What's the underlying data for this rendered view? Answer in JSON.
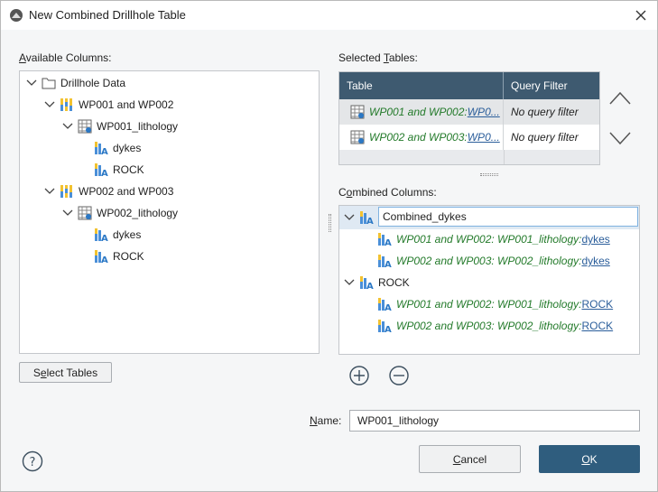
{
  "window": {
    "title": "New Combined Drillhole Table"
  },
  "available_columns": {
    "label": "Available Columns:",
    "label_underline": "A",
    "label_rest": "vailable Columns:",
    "tree": {
      "root": "Drillhole Data",
      "group1": "WP001 and WP002",
      "group1_table": "WP001_lithology",
      "group1_cols": [
        "dykes",
        "ROCK"
      ],
      "group2": "WP002 and WP003",
      "group2_table": "WP002_lithology",
      "group2_cols": [
        "dykes",
        "ROCK"
      ]
    }
  },
  "select_tables_button": {
    "pre": "S",
    "underline": "e",
    "post": "lect Tables"
  },
  "selected_tables": {
    "label_pre": "Selected ",
    "label_underline": "T",
    "label_post": "ables:",
    "headers": [
      "Table",
      "Query Filter"
    ],
    "rows": [
      {
        "prefix": "WP001 and WP002: ",
        "link": "WP0...",
        "filter": "No query filter"
      },
      {
        "prefix": "WP002 and WP003: ",
        "link": "WP0...",
        "filter": "No query filter"
      }
    ]
  },
  "combined_columns": {
    "label_pre": "C",
    "label_underline": "o",
    "label_post": "mbined Columns:",
    "editing_value": "Combined_dykes",
    "items": [
      {
        "prefix": "WP001 and WP002: WP001_lithology: ",
        "link": "dykes"
      },
      {
        "prefix": "WP002 and WP003: WP002_lithology: ",
        "link": "dykes"
      }
    ],
    "group2": "ROCK",
    "items2": [
      {
        "prefix": "WP001 and WP002: WP001_lithology: ",
        "link": "ROCK"
      },
      {
        "prefix": "WP002 and WP003: WP002_lithology: ",
        "link": "ROCK"
      }
    ]
  },
  "name_field": {
    "label_underline": "N",
    "label_post": "ame:",
    "value": "WP001_lithology"
  },
  "buttons": {
    "cancel_underline": "C",
    "cancel_post": "ancel",
    "ok_underline": "O",
    "ok_post": "K"
  },
  "colors": {
    "accent": "#2f5d7e",
    "header": "#3e5a70",
    "green": "#237a2a",
    "link": "#2a5d9a"
  },
  "icons": [
    "app-icon",
    "close-icon",
    "help-icon",
    "chevron-up-icon",
    "chevron-down-icon",
    "add-icon",
    "remove-icon",
    "folder-icon",
    "drillhole-icon",
    "table-icon",
    "category-column-icon"
  ]
}
